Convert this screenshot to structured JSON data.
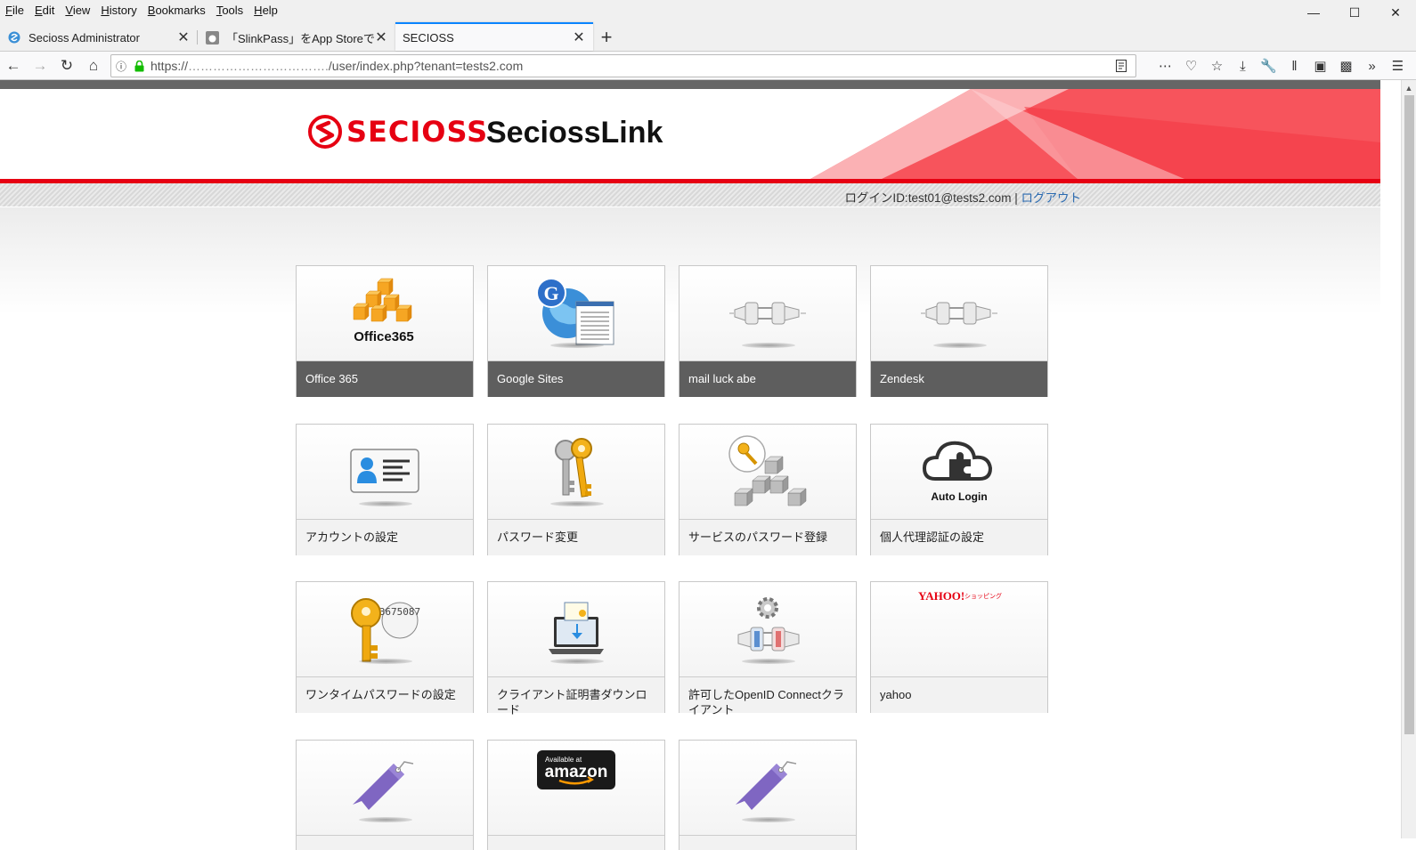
{
  "menu": [
    "File",
    "Edit",
    "View",
    "History",
    "Bookmarks",
    "Tools",
    "Help"
  ],
  "tabs": [
    {
      "label": "Secioss Administrator",
      "active": false
    },
    {
      "label": "「SlinkPass」をApp Storeで",
      "active": false
    },
    {
      "label": "SECIOSS",
      "active": true
    }
  ],
  "url": {
    "prefix": "https://",
    "masked": "…………………………….",
    "path": "/user/index.php?tenant=tests2.com"
  },
  "header": {
    "brand": "SECIOSS",
    "title": "SeciossLink"
  },
  "userbar": {
    "login": "ログインID:test01@tests2.com",
    "separator": "|",
    "logout": "ログアウト"
  },
  "tiles": [
    {
      "label": "Office 365",
      "icon": "office365-icon",
      "icon_text": "Office365",
      "dark": true
    },
    {
      "label": "Google Sites",
      "icon": "google-sites-icon",
      "icon_text": "G",
      "dark": true
    },
    {
      "label": "mail luck abe",
      "icon": "plug-connector-icon",
      "dark": true
    },
    {
      "label": "Zendesk",
      "icon": "plug-connector-icon",
      "dark": true
    },
    {
      "label": "アカウントの設定",
      "icon": "id-card-icon",
      "dark": false
    },
    {
      "label": "パスワード変更",
      "icon": "keys-icon",
      "dark": false
    },
    {
      "label": "サービスのパスワード登録",
      "icon": "key-cubes-icon",
      "dark": false
    },
    {
      "label": "個人代理認証の設定",
      "icon": "auto-login-cloud-icon",
      "icon_text": "Auto Login",
      "dark": false
    },
    {
      "label": "ワンタイムパスワードの設定",
      "icon": "otp-key-icon",
      "icon_text": "3675087",
      "dark": false
    },
    {
      "label": "クライアント証明書ダウンロード",
      "icon": "certificate-laptop-icon",
      "dark": false
    },
    {
      "label": "許可したOpenID Connectクライアント",
      "icon": "gear-plug-icon",
      "dark": false
    },
    {
      "label": "yahoo",
      "icon": "yahoo-logo-icon",
      "icon_text": "YAHOO!",
      "icon_sub": "ショッピング",
      "dark": false
    },
    {
      "label": "",
      "icon": "bookmark-icon",
      "dark": false
    },
    {
      "label": "",
      "icon": "amazon-logo-icon",
      "icon_text": "amazon",
      "icon_sub": "Available at",
      "dark": false
    },
    {
      "label": "",
      "icon": "bookmark-icon",
      "dark": false
    }
  ],
  "colors": {
    "brand_red": "#e60012",
    "tab_accent": "#0a84ff",
    "dark_label": "#5e5e5e",
    "link": "#2a6ab0"
  }
}
